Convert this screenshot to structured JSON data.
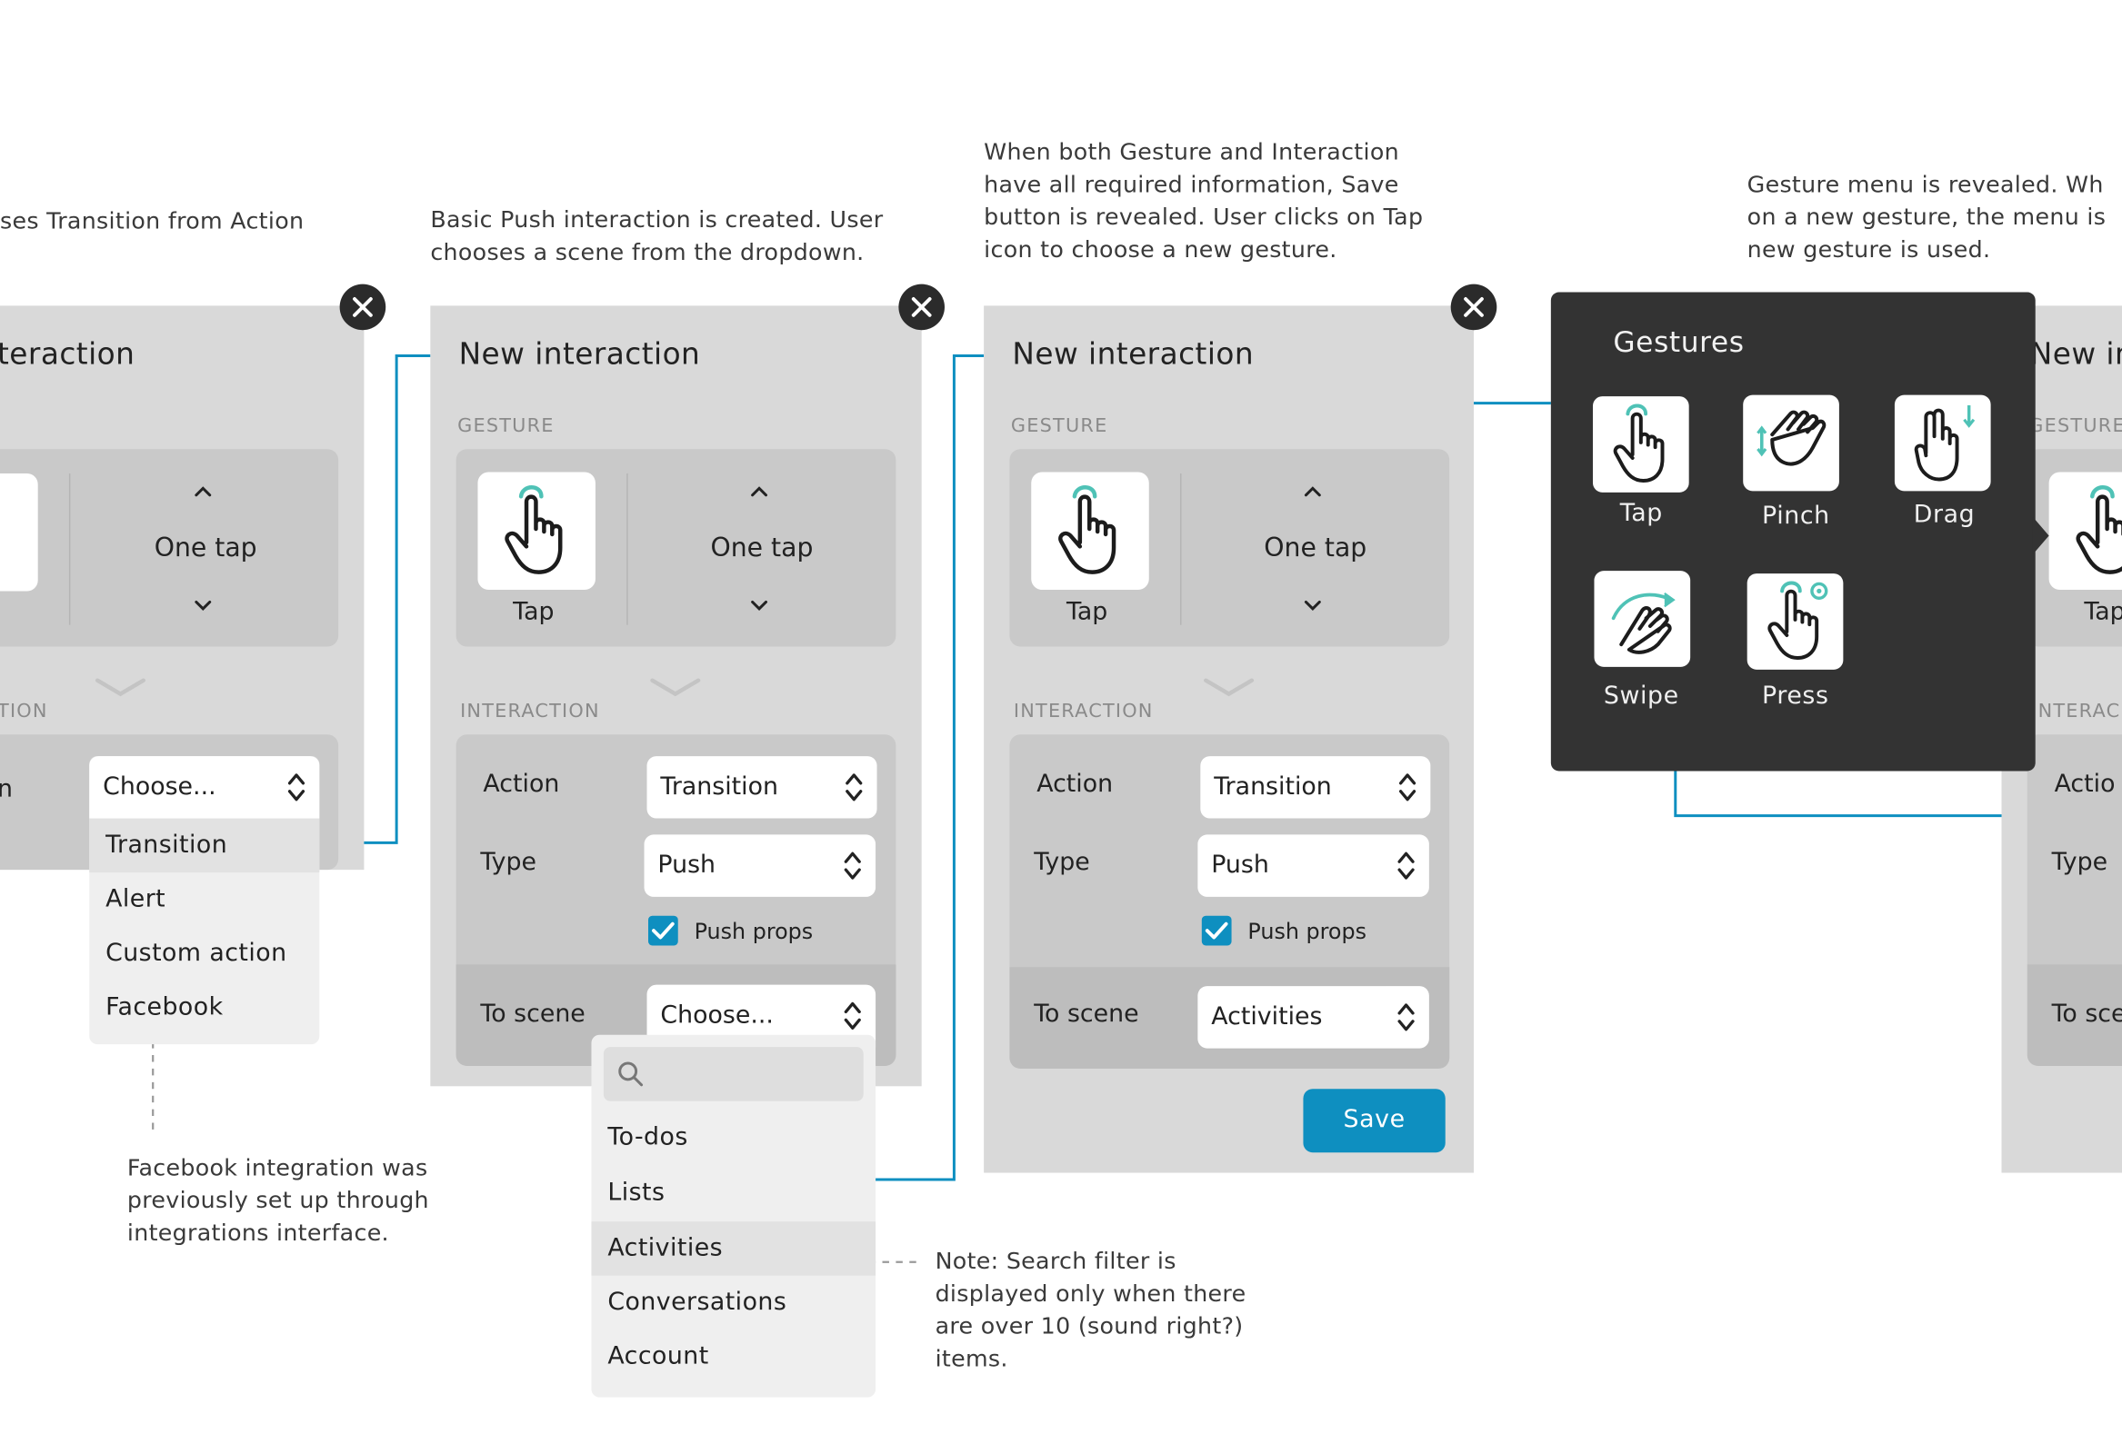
{
  "captions": {
    "c1": "ses Transition from Action",
    "c2": [
      "Basic Push interaction is created. User",
      "chooses a scene from the dropdown."
    ],
    "c3": [
      "When both Gesture and Interaction",
      "have all required information, Save",
      "button is revealed. User clicks on Tap",
      "icon to choose a new gesture."
    ],
    "c4": [
      "Gesture menu is revealed. Wh",
      "on a new gesture, the menu is",
      "new gesture is used."
    ],
    "facebook_note": [
      "Facebook integration was",
      "previously set up through",
      "integrations interface."
    ],
    "search_note": [
      "Note: Search filter is",
      "displayed only when there",
      "are over 10 (sound right?)",
      "items."
    ]
  },
  "panel1": {
    "title": "teraction",
    "gesture_value": "One tap",
    "interaction_label": "TION",
    "action_label": "n",
    "action_select": "Choose...",
    "action_options": [
      "Transition",
      "Alert",
      "Custom action",
      "Facebook"
    ]
  },
  "panel2": {
    "title": "New interaction",
    "gesture_section": "GESTURE",
    "gesture_name": "Tap",
    "gesture_value": "One tap",
    "interaction_section": "INTERACTION",
    "action_label": "Action",
    "action_value": "Transition",
    "type_label": "Type",
    "type_value": "Push",
    "push_props": "Push props",
    "push_props_checked": true,
    "to_scene_label": "To scene",
    "to_scene_value": "Choose...",
    "search_placeholder": "",
    "scene_options": [
      "To-dos",
      "Lists",
      "Activities",
      "Conversations",
      "Account"
    ]
  },
  "panel3": {
    "title": "New interaction",
    "gesture_section": "GESTURE",
    "gesture_name": "Tap",
    "gesture_value": "One tap",
    "interaction_section": "INTERACTION",
    "action_label": "Action",
    "action_value": "Transition",
    "type_label": "Type",
    "type_value": "Push",
    "push_props": "Push props",
    "push_props_checked": true,
    "to_scene_label": "To scene",
    "to_scene_value": "Activities",
    "save_label": "Save"
  },
  "gestures_menu": {
    "title": "Gestures",
    "items": [
      "Tap",
      "Pinch",
      "Drag",
      "Swipe",
      "Press"
    ]
  },
  "panel4": {
    "title": "New in",
    "gesture_section": "GESTURE",
    "gesture_name": "Tap",
    "interaction_section": "INTERAC",
    "action_label": "Actio",
    "type_label": "Type",
    "to_scene_label": "To sce"
  },
  "colors": {
    "accent": "#0e8fc0",
    "teal_icon": "#4fc2b6",
    "panel_bg": "#d9d9d9",
    "dark_menu": "#333333"
  }
}
